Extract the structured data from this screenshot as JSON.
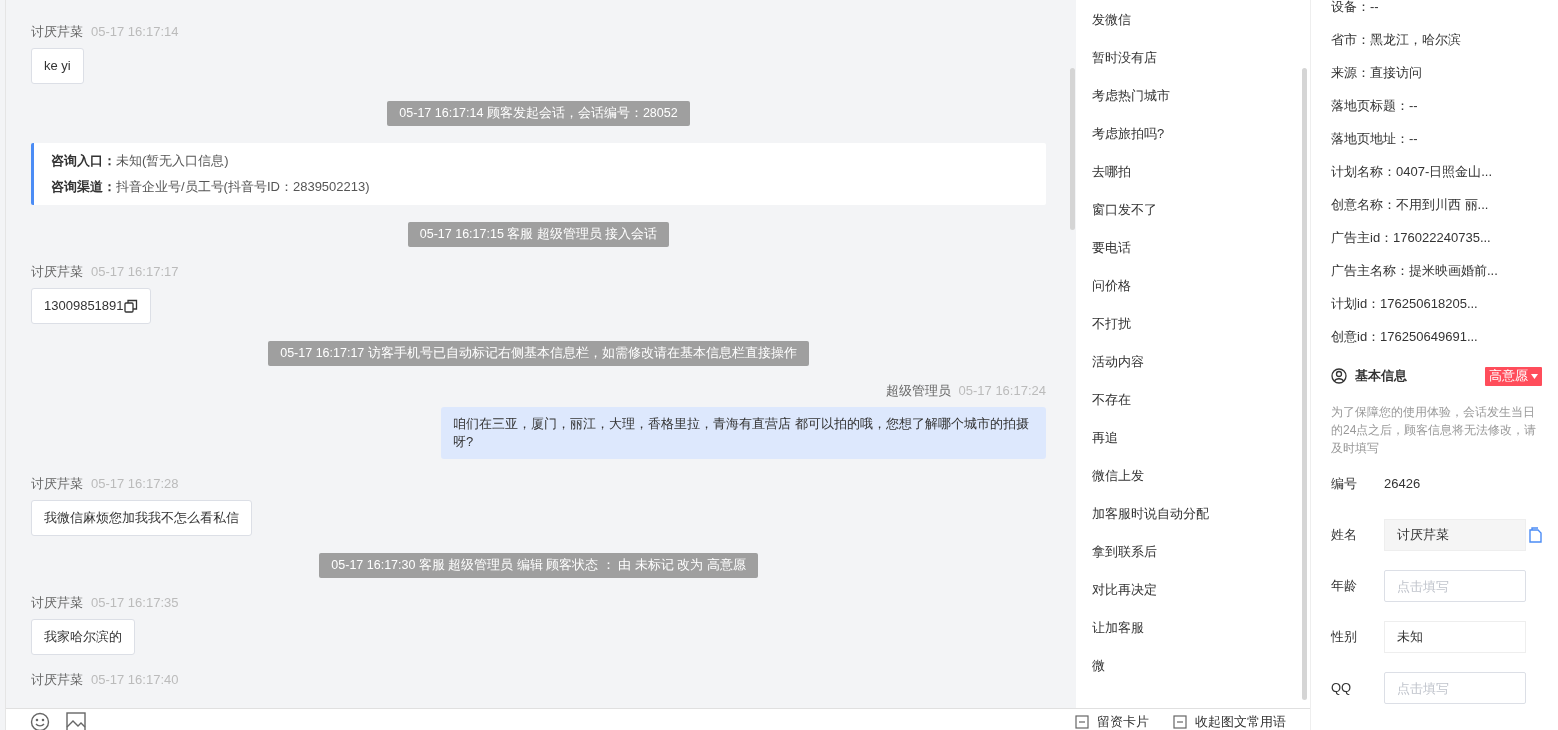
{
  "messages": [
    {
      "kind": "customer",
      "sender": "讨厌芹菜",
      "time": "05-17 16:17:14",
      "text": "ke yi",
      "copyable": false
    },
    {
      "kind": "system",
      "text": "05-17 16:17:14 顾客发起会话，会话编号：28052"
    },
    {
      "kind": "entry",
      "rows": [
        {
          "label": "咨询入口：",
          "value": "未知(暂无入口信息)"
        },
        {
          "label": "咨询渠道：",
          "value": "抖音企业号/员工号(抖音号ID：2839502213)"
        }
      ]
    },
    {
      "kind": "system",
      "text": "05-17 16:17:15 客服 超级管理员 接入会话"
    },
    {
      "kind": "customer",
      "sender": "讨厌芹菜",
      "time": "05-17 16:17:17",
      "text": "13009851891",
      "copyable": true
    },
    {
      "kind": "system",
      "text": "05-17 16:17:17 访客手机号已自动标记右侧基本信息栏，如需修改请在基本信息栏直接操作"
    },
    {
      "kind": "agent",
      "sender": "超级管理员",
      "time": "05-17 16:17:24",
      "text": "咱们在三亚，厦门，丽江，大理，香格里拉，青海有直营店 都可以拍的哦，您想了解哪个城市的拍摄呀?"
    },
    {
      "kind": "customer",
      "sender": "讨厌芹菜",
      "time": "05-17 16:17:28",
      "text": "我微信麻烦您加我我不怎么看私信",
      "copyable": false
    },
    {
      "kind": "system",
      "text": "05-17 16:17:30 客服 超级管理员 编辑 顾客状态 ： 由 未标记 改为 高意愿"
    },
    {
      "kind": "customer",
      "sender": "讨厌芹菜",
      "time": "05-17 16:17:35",
      "text": "我家哈尔滨的",
      "copyable": false
    },
    {
      "kind": "customer",
      "sender": "讨厌芹菜",
      "time": "05-17 16:17:40"
    }
  ],
  "quick_replies": [
    "发微信",
    "暂时没有店",
    "考虑热门城市",
    "考虑旅拍吗?",
    "去哪拍",
    "窗口发不了",
    "要电话",
    "问价格",
    "不打扰",
    "活动内容",
    "不存在",
    "再追",
    "微信上发",
    "加客服时说自动分配",
    "拿到联系后",
    "对比再决定",
    "让加客服",
    "微"
  ],
  "bottom_actions": [
    "留资卡片",
    "收起图文常用语"
  ],
  "source_info": [
    "设备：--",
    "省市：黑龙江，哈尔滨",
    "来源：直接访问",
    "落地页标题：--",
    "落地页地址：--",
    "计划名称：0407-日照金山...",
    "创意名称：不用到川西 丽...",
    "广告主id：176022240735...",
    "广告主名称：提米映画婚前...",
    "计划id：176250618205...",
    "创意id：176250649691..."
  ],
  "basic_info": {
    "title": "基本信息",
    "intent_tag": "高意愿",
    "note": "为了保障您的使用体验，会话发生当日的24点之后，顾客信息将无法修改，请及时填写",
    "fields": [
      {
        "kind": "text",
        "label": "编号",
        "value": "26426"
      },
      {
        "kind": "readonly",
        "label": "姓名",
        "value": "讨厌芹菜"
      },
      {
        "kind": "input",
        "label": "年龄",
        "placeholder": "点击填写"
      },
      {
        "kind": "select",
        "label": "性别",
        "value": "未知"
      },
      {
        "kind": "input",
        "label": "QQ",
        "placeholder": "点击填写"
      }
    ]
  }
}
